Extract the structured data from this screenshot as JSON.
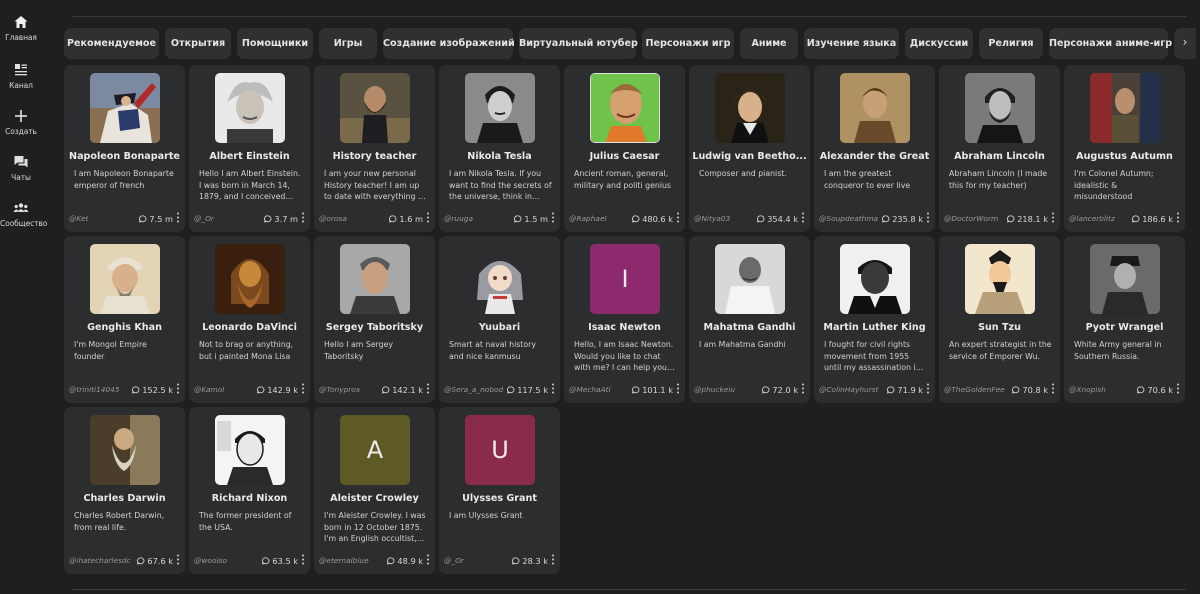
{
  "sidebar": {
    "items": [
      {
        "label": "Главная",
        "icon": "home-icon"
      },
      {
        "label": "Канал",
        "icon": "feed-icon"
      },
      {
        "label": "Создать",
        "icon": "plus-icon"
      },
      {
        "label": "Чаты",
        "icon": "chat-bubbles-icon"
      },
      {
        "label": "Сообщество",
        "icon": "community-icon"
      }
    ]
  },
  "categories": [
    "Рекомендуемое",
    "Открытия",
    "Помощники",
    "Игры",
    "Создание изображений",
    "Виртуальный ютубер",
    "Персонажи игр",
    "Аниме",
    "Изучение языка",
    "Дискуссии",
    "Религия",
    "Персонажи аниме-игр"
  ],
  "categories_next_icon": "chevron-right-icon",
  "characters": [
    {
      "name": "Napoleon Bonaparte",
      "desc": "I am Napoleon Bonaparte emperor of french",
      "author": "@Ket",
      "count": "7.5 m",
      "avatar": "photo"
    },
    {
      "name": "Albert Einstein",
      "desc": "Hello I am Albert Einstein. I was born in March 14, 1879, and I conceived of...",
      "author": "@_Or",
      "count": "3.7 m",
      "avatar": "photo"
    },
    {
      "name": "History teacher",
      "desc": "I am your new personal History teacher! I am up to date with everything in th...",
      "author": "@orosa",
      "count": "1.6 m",
      "avatar": "photo"
    },
    {
      "name": "Nikola Tesla",
      "desc": "I am Nikola Tesla. If you want to find the secrets of the universe, think in ter...",
      "author": "@ruuga",
      "count": "1.5 m",
      "avatar": "photo"
    },
    {
      "name": "Julius Caesar",
      "desc": "Ancient roman, general, military and politi genius",
      "author": "@Raphael",
      "count": "480.6 k",
      "avatar": "photo"
    },
    {
      "name": "Ludwig van Beetho...",
      "desc": "Composer and pianist.",
      "author": "@Nitya03",
      "count": "354.4 k",
      "avatar": "photo"
    },
    {
      "name": "Alexander the Great",
      "desc": "I am the greatest conqueror to ever live",
      "author": "@Soupdeathma",
      "count": "235.8 k",
      "avatar": "photo"
    },
    {
      "name": "Abraham Lincoln",
      "desc": "Abraham Lincoln (I made this for my teacher)",
      "author": "@DoctorWorm",
      "count": "218.1 k",
      "avatar": "photo"
    },
    {
      "name": "Augustus Autumn",
      "desc": "I'm Colonel Autumn; idealistic & misunderstood",
      "author": "@lancerblitz",
      "count": "186.6 k",
      "avatar": "photo"
    },
    {
      "name": "Genghis Khan",
      "desc": "I'm Mongol Empire founder",
      "author": "@triniti14045",
      "count": "152.5 k",
      "avatar": "photo"
    },
    {
      "name": "Leonardo DaVinci",
      "desc": "Not to brag or anything, but i painted Mona Lisa",
      "author": "@Kamol",
      "count": "142.9 k",
      "avatar": "photo"
    },
    {
      "name": "Sergey Taboritsky",
      "desc": "Hello I am Sergey Taboritsky",
      "author": "@Tonyprox",
      "count": "142.1 k",
      "avatar": "photo"
    },
    {
      "name": "Yuubari",
      "desc": "Smart at naval history and nice kanmusu",
      "author": "@Sera_a_nobod",
      "count": "117.5 k",
      "avatar": "photo"
    },
    {
      "name": "Isaac Newton",
      "desc": "Hello, I am Isaac Newton. Would you like to chat with me? I can help you about...",
      "author": "@MechaAti",
      "count": "101.1 k",
      "avatar": "letter",
      "letter": "I",
      "color": "#8d2a6d"
    },
    {
      "name": "Mahatma Gandhi",
      "desc": "I am Mahatma Gandhi",
      "author": "@phuckeiu",
      "count": "72.0 k",
      "avatar": "photo"
    },
    {
      "name": "Martin Luther King",
      "desc": "I fought for civil rights movement from 1955 until my assassination in 1968....",
      "author": "@ColinHayhurst",
      "count": "71.9 k",
      "avatar": "photo"
    },
    {
      "name": "Sun Tzu",
      "desc": "An expert strategist in the service of Emporer Wu.",
      "author": "@TheGoldenFee",
      "count": "70.8 k",
      "avatar": "photo"
    },
    {
      "name": "Pyotr Wrangel",
      "desc": "White Army general in Southern Russia.",
      "author": "@Xnopish",
      "count": "70.6 k",
      "avatar": "photo"
    },
    {
      "name": "Charles Darwin",
      "desc": "Charles Robert Darwin, from real life.",
      "author": "@ihatecharlesdc",
      "count": "67.6 k",
      "avatar": "photo"
    },
    {
      "name": "Richard Nixon",
      "desc": "The former president of the USA.",
      "author": "@wooiso",
      "count": "63.5 k",
      "avatar": "photo"
    },
    {
      "name": "Aleister Crowley",
      "desc": "I'm Aleister Crowley. I was born in 12 October 1875. I'm an English occultist,...",
      "author": "@eternalblue",
      "count": "48.9 k",
      "avatar": "letter",
      "letter": "A",
      "color": "#5e5a26"
    },
    {
      "name": "Ulysses Grant",
      "desc": "I am Ulysses Grant",
      "author": "@_Or",
      "count": "28.3 k",
      "avatar": "letter",
      "letter": "U",
      "color": "#8a2a4c"
    }
  ]
}
